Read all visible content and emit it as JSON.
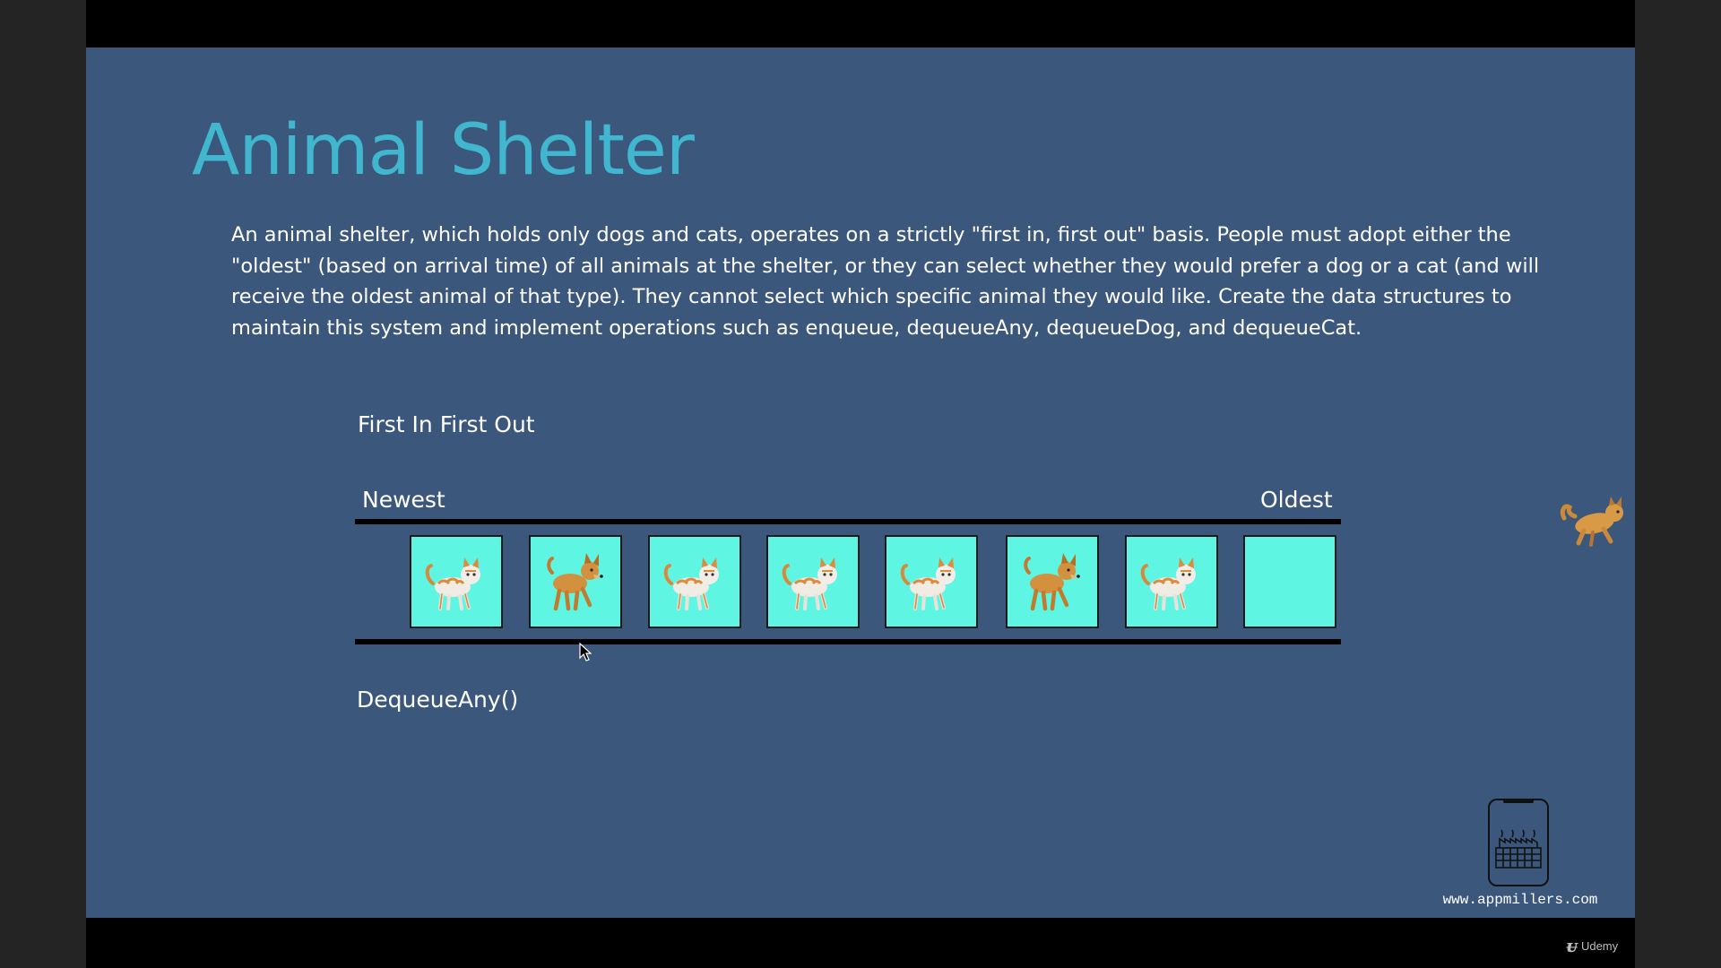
{
  "slide": {
    "title": "Animal Shelter",
    "description": "An animal shelter, which holds only dogs and cats, operates on a strictly \"first in, first out\" basis. People must adopt either the \"oldest\" (based on arrival time) of all animals at the shelter, or they can select whether they would prefer a dog or a cat (and will receive the oldest animal of that type). They cannot select which specific animal they would like. Create the data structures to maintain this system and implement operations such as enqueue, dequeueAny, dequeueDog, and dequeueCat.",
    "fifo_label": "First In First Out",
    "newest_label": "Newest",
    "oldest_label": "Oldest",
    "dequeue_label": "DequeueAny()",
    "slot_color": "#5ff5e3",
    "title_color": "#40b6cf",
    "background_color": "#3c577c",
    "queue": [
      {
        "animal": "cat-icon"
      },
      {
        "animal": "dog-icon"
      },
      {
        "animal": "cat-icon"
      },
      {
        "animal": "cat-icon"
      },
      {
        "animal": "cat-icon"
      },
      {
        "animal": "dog-icon"
      },
      {
        "animal": "cat-icon"
      },
      {
        "animal": "empty"
      }
    ],
    "leaving_animal": "cat-icon"
  },
  "footer": {
    "site_url": "www.appmillers.com",
    "brand": "Udemy"
  }
}
